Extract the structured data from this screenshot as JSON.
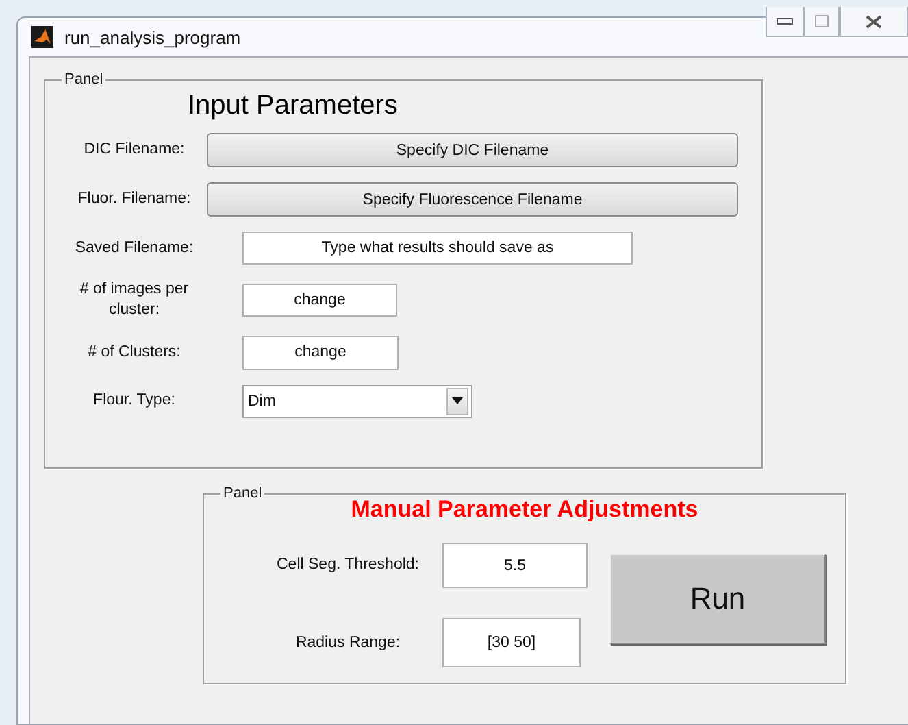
{
  "window": {
    "title": "run_analysis_program"
  },
  "input_panel": {
    "legend": "Panel",
    "title": "Input Parameters",
    "rows": [
      {
        "kind": "button",
        "label": "DIC Filename:",
        "text": "Specify DIC Filename"
      },
      {
        "kind": "button",
        "label": "Fluor. Filename:",
        "text": "Specify Fluorescence Filename"
      },
      {
        "kind": "field",
        "label": "Saved Filename:",
        "value": "Type what results should save as"
      },
      {
        "kind": "field",
        "label": "# of images per cluster:",
        "value": "change"
      },
      {
        "kind": "field",
        "label": "# of Clusters:",
        "value": "change"
      },
      {
        "kind": "dropdown",
        "label": "Flour. Type:",
        "value": "Dim"
      }
    ]
  },
  "adjust_panel": {
    "legend": "Panel",
    "title": "Manual Parameter Adjustments",
    "fields": [
      {
        "label": "Cell Seg. Threshold:",
        "value": "5.5"
      },
      {
        "label": "Radius Range:",
        "value": "[30 50]"
      }
    ],
    "run_button": "Run"
  }
}
